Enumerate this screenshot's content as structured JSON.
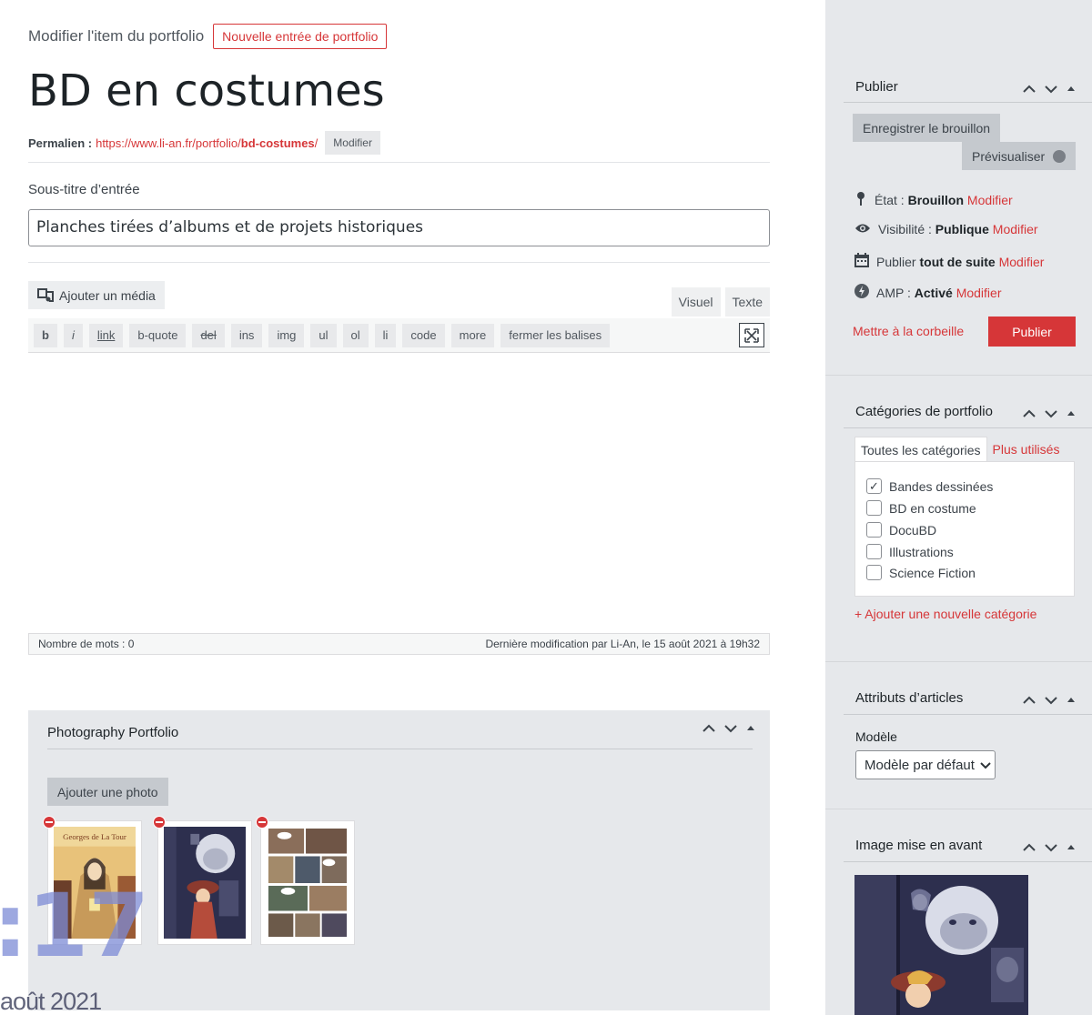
{
  "header": {
    "heading": "Modifier l'item du portfolio",
    "new_button": "Nouvelle entrée de portfolio"
  },
  "post": {
    "title": "BD en costumes",
    "permalink_label": "Permalien :",
    "permalink_url_base": "https://www.li-an.fr/portfolio/",
    "permalink_slug": "bd-costumes",
    "permalink_trailing": "/",
    "permalink_edit": "Modifier",
    "subtitle_label": "Sous-titre d’entrée",
    "subtitle_value": "Planches tirées d’albums et de projets historiques"
  },
  "editor": {
    "add_media": "Ajouter un média",
    "tabs": [
      "Visuel",
      "Texte"
    ],
    "quicktags": [
      "b",
      "i",
      "link",
      "b-quote",
      "del",
      "ins",
      "img",
      "ul",
      "ol",
      "li",
      "code",
      "more",
      "fermer les balises"
    ],
    "word_count": "Nombre de mots : 0",
    "last_modified": "Dernière modification par Li-An, le 15 août 2021 à 19h32"
  },
  "portfolio": {
    "title": "Photography Portfolio",
    "add_photo": "Ajouter une photo",
    "thumb1_text": "Georges de La Tour"
  },
  "overlay": {
    "number": ":17",
    "date": "août 2021"
  },
  "sidebar": {
    "publish": {
      "title": "Publier",
      "save_draft": "Enregistrer le brouillon",
      "preview": "Prévisualiser",
      "state_label": "État :",
      "state_value": "Brouillon",
      "visibility_label": "Visibilité :",
      "visibility_value": "Publique",
      "publish_label": "Publier",
      "publish_value": "tout de suite",
      "amp_label": "AMP :",
      "amp_value": "Activé",
      "edit": "Modifier",
      "trash": "Mettre à la corbeille",
      "publish_button": "Publier"
    },
    "categories": {
      "title": "Catégories de portfolio",
      "tab_all": "Toutes les catégories",
      "tab_popular": "Plus utilisés",
      "items": [
        {
          "label": "Bandes dessinées",
          "checked": true
        },
        {
          "label": "BD en costume",
          "checked": false
        },
        {
          "label": "DocuBD",
          "checked": false
        },
        {
          "label": "Illustrations",
          "checked": false
        },
        {
          "label": "Science Fiction",
          "checked": false
        }
      ],
      "add_new": "+ Ajouter une nouvelle catégorie"
    },
    "attributes": {
      "title": "Attributs d’articles",
      "template_label": "Modèle",
      "template_value": "Modèle par défaut"
    },
    "featured": {
      "title": "Image mise en avant"
    }
  },
  "colors": {
    "accent_red": "#d63638",
    "sidebar_bg": "#e6e8eb",
    "overlay_blue": "#7d8bd6"
  }
}
